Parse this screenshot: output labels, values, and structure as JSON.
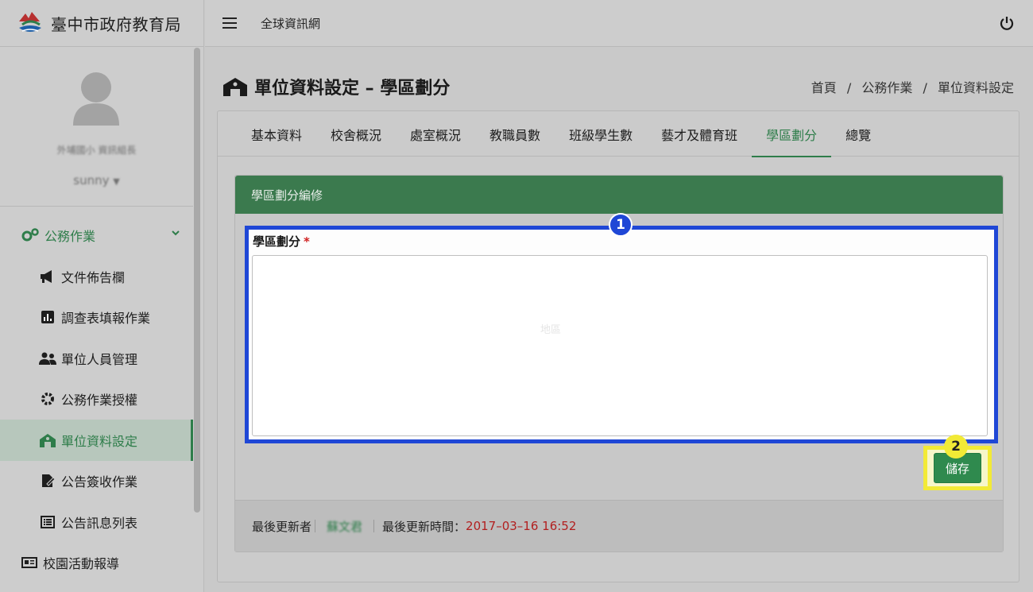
{
  "app": {
    "title": "臺中市政府教育局"
  },
  "topbar": {
    "link_label": "全球資訊網"
  },
  "user": {
    "subtitle": "外埔國小 資訊組長",
    "name": "sunny"
  },
  "sidebar": {
    "group_label": "公務作業",
    "items": [
      {
        "label": "文件佈告欄",
        "icon": "megaphone-icon"
      },
      {
        "label": "調查表填報作業",
        "icon": "chart-icon"
      },
      {
        "label": "單位人員管理",
        "icon": "users-icon"
      },
      {
        "label": "公務作業授權",
        "icon": "gear-icon"
      },
      {
        "label": "單位資料設定",
        "icon": "building-icon",
        "active": true
      },
      {
        "label": "公告簽收作業",
        "icon": "sign-icon"
      },
      {
        "label": "公告訊息列表",
        "icon": "list-icon"
      }
    ],
    "bottom_item": {
      "label": "校園活動報導",
      "icon": "news-icon"
    }
  },
  "page": {
    "title": "單位資料設定 – 學區劃分",
    "breadcrumb": [
      "首頁",
      "公務作業",
      "單位資料設定"
    ]
  },
  "tabs": [
    "基本資料",
    "校舍概況",
    "處室概況",
    "教職員數",
    "班級學生數",
    "藝才及體育班",
    "學區劃分",
    "總覽"
  ],
  "active_tab": "學區劃分",
  "panel": {
    "header": "學區劃分編修",
    "field_label": "學區劃分",
    "required_mark": "*",
    "textarea_value": "",
    "ghost_text": "地區",
    "save_label": "儲存"
  },
  "footer": {
    "updater_label": "最後更新者",
    "updater_name": "蘇文君",
    "time_label": "最後更新時間：",
    "time_value": "2017–03–16 16:52"
  },
  "annotations": {
    "badge1": "1",
    "badge2": "2"
  },
  "colors": {
    "accent": "#2e7d4a",
    "highlight_blue": "#1f47d6",
    "highlight_yellow": "#f2ea36",
    "time_red": "#b21f1f"
  }
}
